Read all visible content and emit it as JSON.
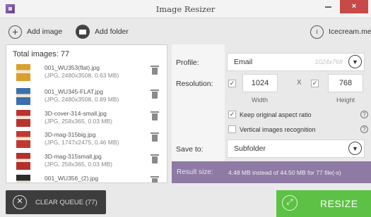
{
  "window": {
    "title": "Image Resizer",
    "close_glyph": "×"
  },
  "toolbar": {
    "add_image": "Add image",
    "add_folder": "Add folder",
    "account": "Icecream.me"
  },
  "files": {
    "total_label": "Total images: 77",
    "items": [
      {
        "name": "001_WU353(flat).jpg",
        "meta": "(JPG, 2480x3508, 0.63 MB)",
        "thumb_color": "#d9a12a"
      },
      {
        "name": "001_WU345-FLAT.jpg",
        "meta": "(JPG, 2480x3508, 0.89 MB)",
        "thumb_color": "#3a6fb0"
      },
      {
        "name": "3D-cover-314-small.jpg",
        "meta": "(JPG, 258x365, 0.03 MB)",
        "thumb_color": "#b8342c"
      },
      {
        "name": "3D-mag-315big.jpg",
        "meta": "(JPG, 1747x2475, 0.46 MB)",
        "thumb_color": "#c23a2e"
      },
      {
        "name": "3D-mag-315small.jpg",
        "meta": "(JPG, 258x365, 0.03 MB)",
        "thumb_color": "#b5302a"
      },
      {
        "name": "001_WU356_(2).jpg",
        "meta": "",
        "thumb_color": "#2c2c2c"
      }
    ]
  },
  "settings": {
    "profile_label": "Profile:",
    "profile_value": "Email",
    "profile_hint": "1024x768",
    "resolution_label": "Resolution:",
    "width_value": "1024",
    "height_value": "768",
    "x_label": "X",
    "width_label": "Width",
    "height_label": "Height",
    "keep_ratio": "Keep original aspect ratio",
    "vertical": "Vertical images recognition",
    "save_label": "Save to:",
    "save_value": "Subfolder",
    "help_glyph": "?"
  },
  "result": {
    "label": "Result size:",
    "value": "4.48 MB instead of 44.50 MB for 77 file(-s)"
  },
  "actions": {
    "clear": "CLEAR QUEUE (77)",
    "resize": "RESIZE"
  },
  "colors": {
    "accent_green": "#5cc144",
    "result_purple": "#8e7aa4",
    "close_red": "#c74a48"
  }
}
